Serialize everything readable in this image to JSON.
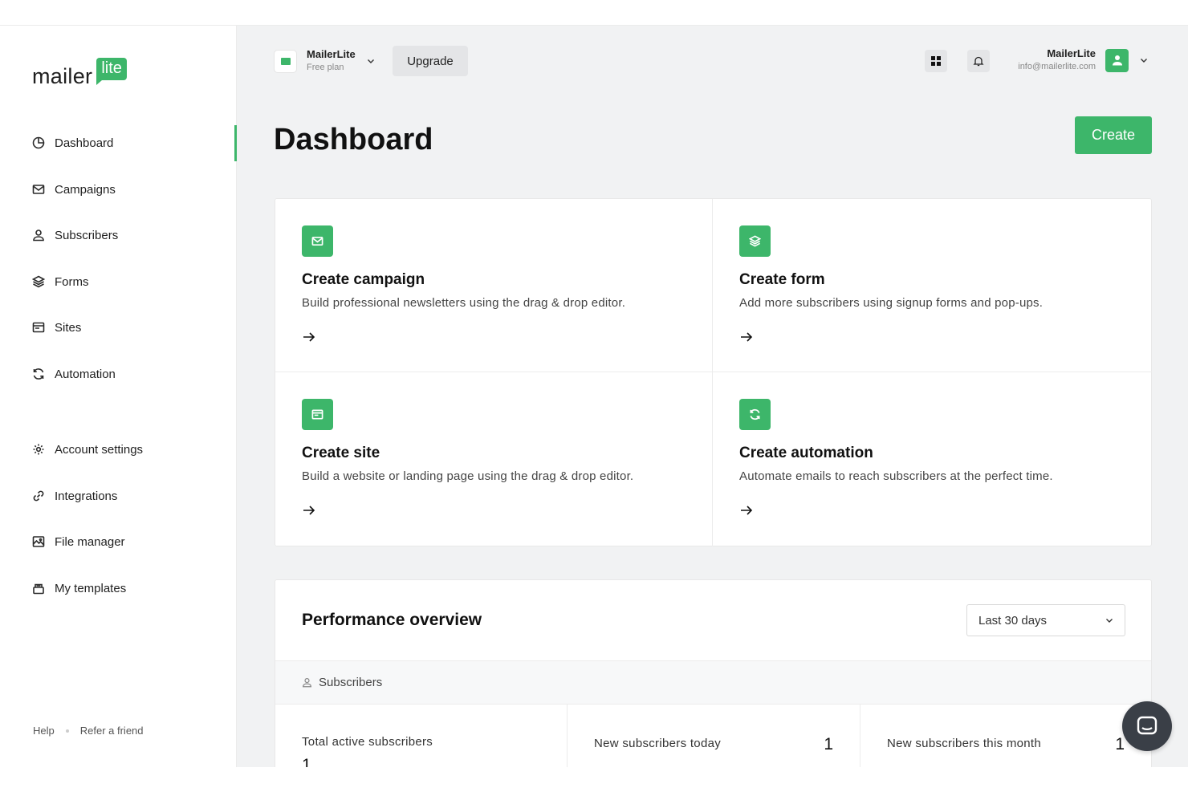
{
  "brand": {
    "word": "mailer",
    "badge": "lite",
    "accent": "#3db66a"
  },
  "sidebar": {
    "items": [
      {
        "label": "Dashboard",
        "icon": "dashboard-icon",
        "active": true
      },
      {
        "label": "Campaigns",
        "icon": "envelope-icon"
      },
      {
        "label": "Subscribers",
        "icon": "user-icon"
      },
      {
        "label": "Forms",
        "icon": "layers-icon"
      },
      {
        "label": "Sites",
        "icon": "browser-icon"
      },
      {
        "label": "Automation",
        "icon": "refresh-icon"
      }
    ],
    "secondary": [
      {
        "label": "Account settings",
        "icon": "gear-icon"
      },
      {
        "label": "Integrations",
        "icon": "link-icon"
      },
      {
        "label": "File manager",
        "icon": "image-icon"
      },
      {
        "label": "My templates",
        "icon": "template-icon"
      }
    ],
    "footer": {
      "help": "Help",
      "refer": "Refer a friend"
    }
  },
  "header": {
    "account_name": "MailerLite",
    "account_plan": "Free plan",
    "upgrade_label": "Upgrade",
    "user_name": "MailerLite",
    "user_email": "info@mailerlite.com"
  },
  "page": {
    "title": "Dashboard",
    "create_label": "Create"
  },
  "actions": [
    {
      "title": "Create campaign",
      "desc": "Build professional newsletters using the drag & drop editor.",
      "icon": "envelope-icon"
    },
    {
      "title": "Create form",
      "desc": "Add more subscribers using signup forms and pop-ups.",
      "icon": "layers-icon"
    },
    {
      "title": "Create site",
      "desc": "Build a website or landing page using the drag & drop editor.",
      "icon": "browser-icon"
    },
    {
      "title": "Create automation",
      "desc": "Automate emails to reach subscribers at the perfect time.",
      "icon": "refresh-icon"
    }
  ],
  "performance": {
    "title": "Performance overview",
    "range": "Last 30 days",
    "section": "Subscribers",
    "stats": [
      {
        "label": "Total active subscribers",
        "value": "1"
      },
      {
        "label": "New subscribers today",
        "value": "1"
      },
      {
        "label": "New subscribers this month",
        "value": "1"
      }
    ]
  }
}
